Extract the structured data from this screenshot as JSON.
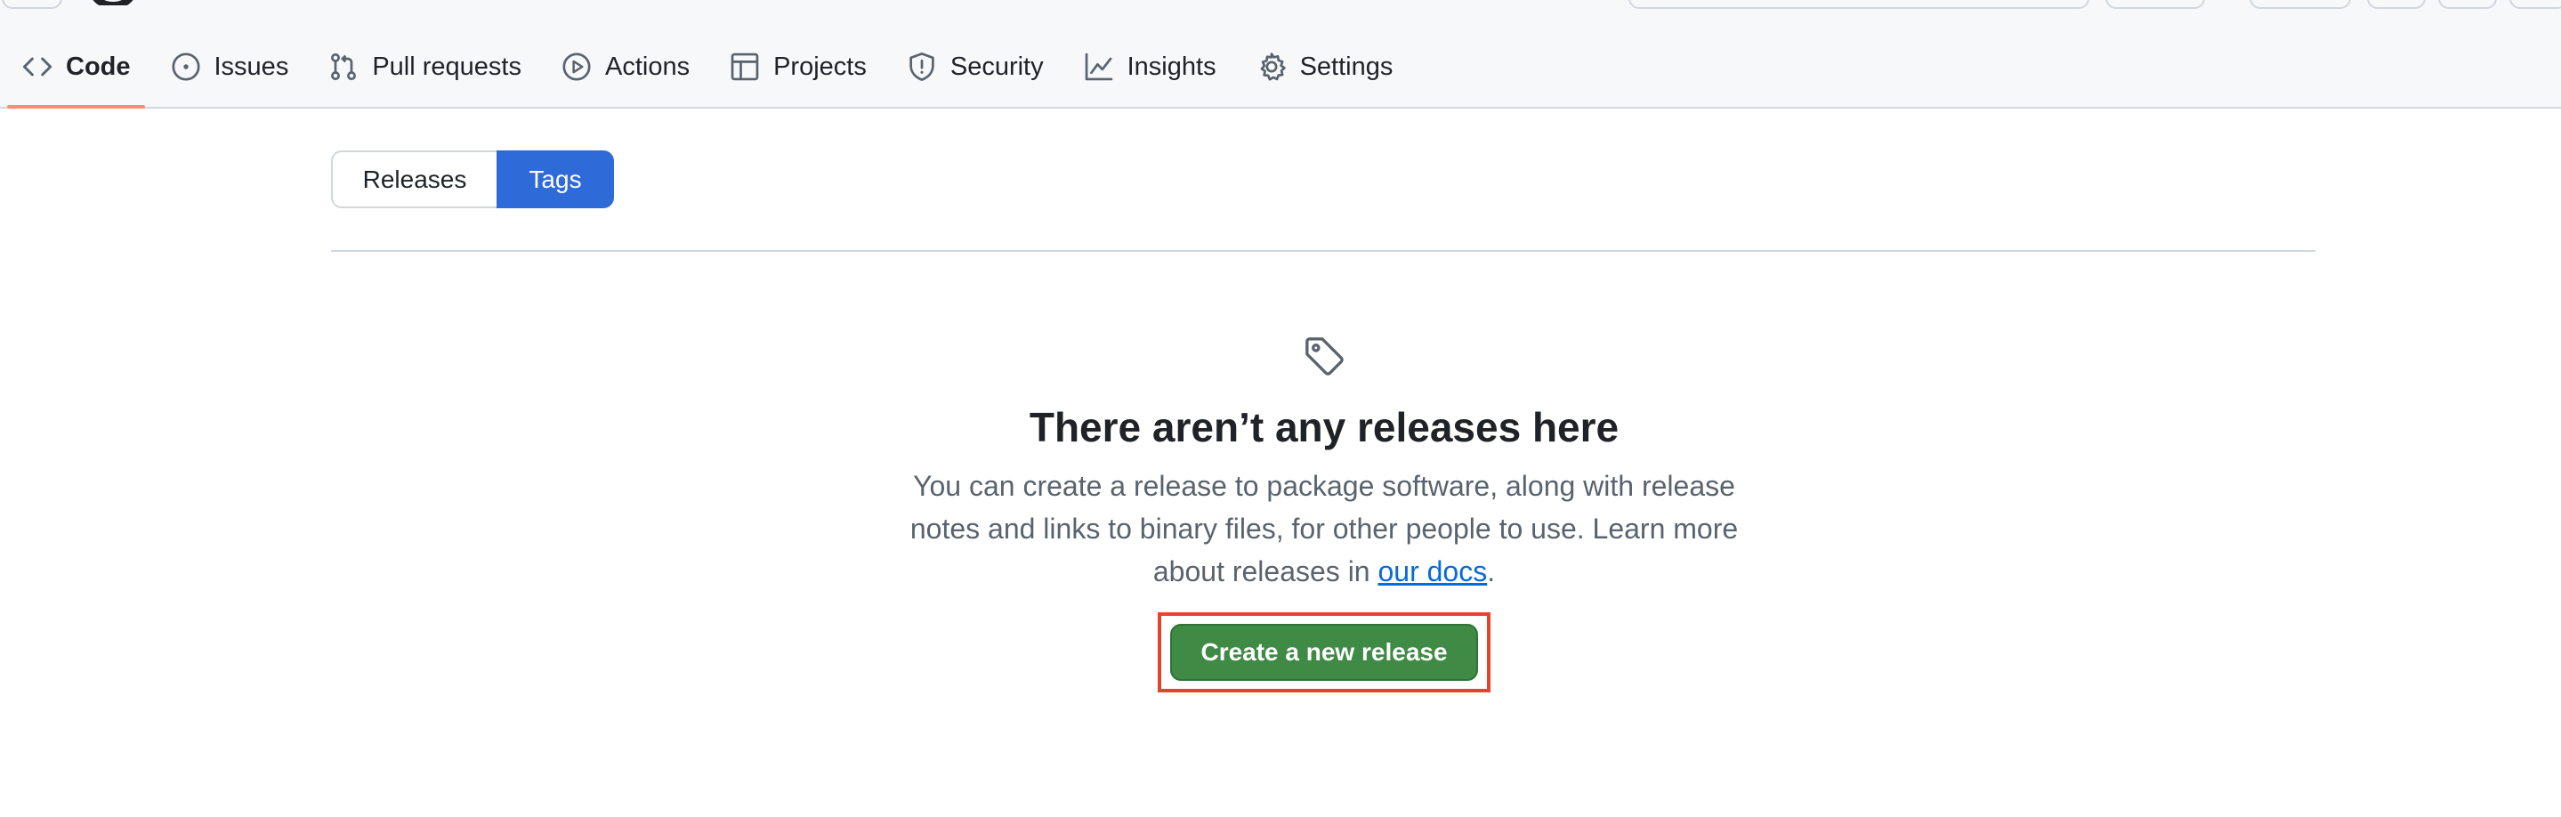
{
  "nav": {
    "tabs": [
      {
        "label": "Code",
        "icon": "code-icon",
        "selected": true
      },
      {
        "label": "Issues",
        "icon": "issue-opened-icon"
      },
      {
        "label": "Pull requests",
        "icon": "git-pull-request-icon"
      },
      {
        "label": "Actions",
        "icon": "play-icon"
      },
      {
        "label": "Projects",
        "icon": "table-icon"
      },
      {
        "label": "Security",
        "icon": "shield-icon"
      },
      {
        "label": "Insights",
        "icon": "graph-icon"
      },
      {
        "label": "Settings",
        "icon": "gear-icon"
      }
    ]
  },
  "subnav": {
    "releases_label": "Releases",
    "tags_label": "Tags",
    "selected": "Tags"
  },
  "blank_state": {
    "icon": "tag-icon",
    "title": "There aren’t any releases here",
    "description_prefix": "You can create a release to package software, along with release notes and links to binary files, for other people to use. Learn more about releases in ",
    "docs_link": "our docs",
    "description_suffix": ".",
    "button_label": "Create a new release"
  },
  "colors": {
    "accent": "#2f6ad9",
    "primary_button": "#3f8a45",
    "selected_tab_underline": "#fd8c73",
    "highlight_box": "#e5432b",
    "link": "#0969da"
  }
}
